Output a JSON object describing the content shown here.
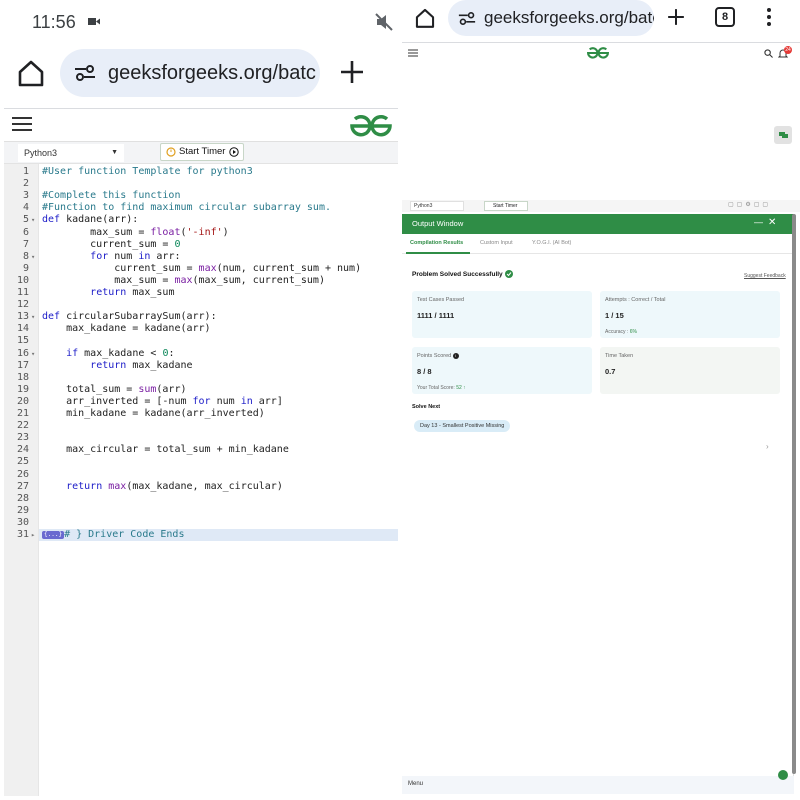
{
  "status": {
    "time": "11:56"
  },
  "left": {
    "url": "geeksforgeeks.org/batc",
    "language": "Python3",
    "timer_label": "Start Timer",
    "code_lines": [
      {
        "n": "1",
        "fold": "",
        "text": "#User function Template for python3",
        "cls": "cm"
      },
      {
        "n": "2",
        "fold": "",
        "text": "",
        "cls": ""
      },
      {
        "n": "3",
        "fold": "",
        "text": "#Complete this function",
        "cls": "cm"
      },
      {
        "n": "4",
        "fold": "",
        "text": "#Function to find maximum circular subarray sum.",
        "cls": "cm"
      },
      {
        "n": "5",
        "fold": "▾",
        "html": "<span class='kw'>def</span> kadane(arr):"
      },
      {
        "n": "6",
        "fold": "",
        "html": "        max_sum = <span class='bi'>float</span>(<span class='str'>'-inf'</span>)"
      },
      {
        "n": "7",
        "fold": "",
        "html": "        current_sum = <span class='num'>0</span>"
      },
      {
        "n": "8",
        "fold": "▾",
        "html": "        <span class='kw'>for</span> num <span class='kw'>in</span> arr:"
      },
      {
        "n": "9",
        "fold": "",
        "html": "            current_sum = <span class='bi'>max</span>(num, current_sum + num)"
      },
      {
        "n": "10",
        "fold": "",
        "html": "            max_sum = <span class='bi'>max</span>(max_sum, current_sum)"
      },
      {
        "n": "11",
        "fold": "",
        "html": "        <span class='kw'>return</span> max_sum"
      },
      {
        "n": "12",
        "fold": "",
        "html": ""
      },
      {
        "n": "13",
        "fold": "▾",
        "html": "<span class='kw'>def</span> circularSubarraySum(arr):"
      },
      {
        "n": "14",
        "fold": "",
        "html": "    max_kadane = kadane(arr)"
      },
      {
        "n": "15",
        "fold": "",
        "html": ""
      },
      {
        "n": "16",
        "fold": "▾",
        "html": "    <span class='kw'>if</span> max_kadane &lt; <span class='num'>0</span>:"
      },
      {
        "n": "17",
        "fold": "",
        "html": "        <span class='kw'>return</span> max_kadane"
      },
      {
        "n": "18",
        "fold": "",
        "html": ""
      },
      {
        "n": "19",
        "fold": "",
        "html": "    total_sum = <span class='bi'>sum</span>(arr)"
      },
      {
        "n": "20",
        "fold": "",
        "html": "    arr_inverted = [-num <span class='kw'>for</span> num <span class='kw'>in</span> arr]"
      },
      {
        "n": "21",
        "fold": "",
        "html": "    min_kadane = kadane(arr_inverted)"
      },
      {
        "n": "22",
        "fold": "",
        "html": ""
      },
      {
        "n": "23",
        "fold": "",
        "html": ""
      },
      {
        "n": "24",
        "fold": "",
        "html": "    max_circular = total_sum + min_kadane"
      },
      {
        "n": "25",
        "fold": "",
        "html": ""
      },
      {
        "n": "26",
        "fold": "",
        "html": ""
      },
      {
        "n": "27",
        "fold": "",
        "html": "    <span class='kw'>return</span> <span class='bi'>max</span>(max_kadane, max_circular)"
      },
      {
        "n": "28",
        "fold": "",
        "html": ""
      },
      {
        "n": "29",
        "fold": "",
        "html": ""
      },
      {
        "n": "30",
        "fold": "",
        "html": ""
      },
      {
        "n": "31",
        "fold": "▸",
        "html": "<span class='fold-tag'>{...}</span><span class='cm'># } Driver Code Ends</span>",
        "highlight": true
      }
    ]
  },
  "right": {
    "url": "geeksforgeeks.org/batc",
    "tab_count": "8",
    "notification_count": "24",
    "language": "Python3",
    "timer_label": "Start Timer",
    "output_window": {
      "title": "Output Window",
      "tabs": [
        "Compilation Results",
        "Custom Input",
        "Y.O.G.I. (AI Bot)"
      ],
      "result_title": "Problem Solved Successfully",
      "feedback": "Suggest Feedback",
      "cards": [
        {
          "label": "Test Cases Passed",
          "value": "1111 / 1111",
          "sub": ""
        },
        {
          "label": "Attempts : Correct / Total",
          "value": "1 / 15",
          "sub": "Accuracy :",
          "sub_value": "6%"
        },
        {
          "label": "Points Scored",
          "value": "8 / 8",
          "sub": "Your Total Score:",
          "sub_value": "52 ↑"
        },
        {
          "label": "Time Taken",
          "value": "0.7",
          "sub": ""
        }
      ],
      "solve_next_label": "Solve Next",
      "solve_next_item": "Day 13 - Smallest Positive Missing"
    },
    "bottom_menu": "Menu"
  },
  "colors": {
    "brand_green": "#2f8d46",
    "url_pill": "#e8eef8"
  }
}
